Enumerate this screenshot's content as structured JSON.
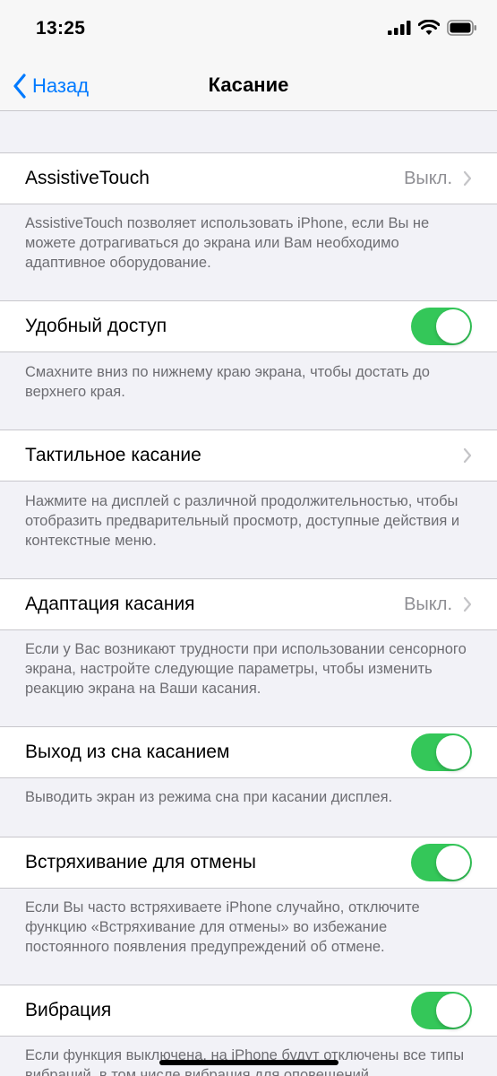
{
  "status_bar": {
    "time": "13:25"
  },
  "nav": {
    "back_label": "Назад",
    "title": "Касание"
  },
  "rows": [
    {
      "label": "AssistiveTouch",
      "value": "Выкл.",
      "footer": "AssistiveTouch позволяет использовать iPhone, если Вы не можете дотрагиваться до экрана или Вам необходимо адаптивное оборудование."
    },
    {
      "label": "Удобный доступ",
      "toggle": true,
      "footer": "Смахните вниз по нижнему краю экрана, чтобы достать до верхнего края."
    },
    {
      "label": "Тактильное касание",
      "footer": "Нажмите на дисплей с различной продолжительностью, чтобы отобразить предварительный просмотр, доступные действия и контекстные меню."
    },
    {
      "label": "Адаптация касания",
      "value": "Выкл.",
      "footer": "Если у Вас возникают трудности при использовании сенсорного экрана, настройте следующие параметры, чтобы изменить реакцию экрана на Ваши касания."
    },
    {
      "label": "Выход из сна касанием",
      "toggle": true,
      "footer": "Выводить экран из режима сна при касании дисплея."
    },
    {
      "label": "Встряхивание для отмены",
      "toggle": true,
      "footer": "Если Вы часто встряхиваете iPhone случайно, отключите функцию «Встряхивание для отмены» во избежание постоянного появления предупреждений об отмене."
    },
    {
      "label": "Вибрация",
      "toggle": true,
      "footer": "Если функция выключена, на iPhone будут отключены все типы вибраций, в том числе вибрация для оповещений"
    }
  ],
  "colors": {
    "accent": "#007aff",
    "toggle_on": "#34c759"
  },
  "icons": [
    "cellular-signal-icon",
    "wifi-icon",
    "battery-icon",
    "chevron-left-icon",
    "chevron-right-icon"
  ]
}
